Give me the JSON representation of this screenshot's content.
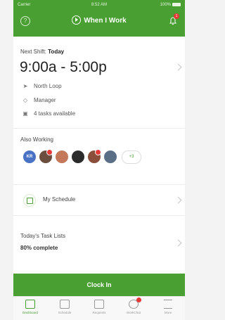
{
  "status_bar": {
    "carrier": "Carrier",
    "time": "8:52 AM",
    "battery": "100%"
  },
  "header": {
    "title": "When I Work",
    "notification_count": "1"
  },
  "next_shift": {
    "label": "Next Shift:",
    "day": "Today",
    "time": "9:00a - 5:00p",
    "location": "North Loop",
    "position": "Manager",
    "tasks": "4 tasks available"
  },
  "also_working": {
    "label": "Also Working",
    "initials": "KR",
    "more": "+3",
    "avatar_colors": [
      "#4a72c4",
      "#6b4e3d",
      "#c47a5a",
      "#2b2b2b",
      "#8a4f3a",
      "#5a6f86"
    ]
  },
  "schedule": {
    "label": "My Schedule"
  },
  "task_lists": {
    "label": "Today's Task Lists",
    "progress": "80% complete"
  },
  "clock_in": {
    "label": "Clock In"
  },
  "tabs": [
    {
      "label": "Dashboard",
      "icon": "dashboard-icon"
    },
    {
      "label": "Schedule",
      "icon": "calendar-icon"
    },
    {
      "label": "Requests",
      "icon": "inbox-icon"
    },
    {
      "label": "WorkChat",
      "icon": "chat-icon"
    },
    {
      "label": "More",
      "icon": "menu-icon"
    }
  ],
  "colors": {
    "brand_green": "#4a9f33",
    "badge_red": "#e53935"
  }
}
